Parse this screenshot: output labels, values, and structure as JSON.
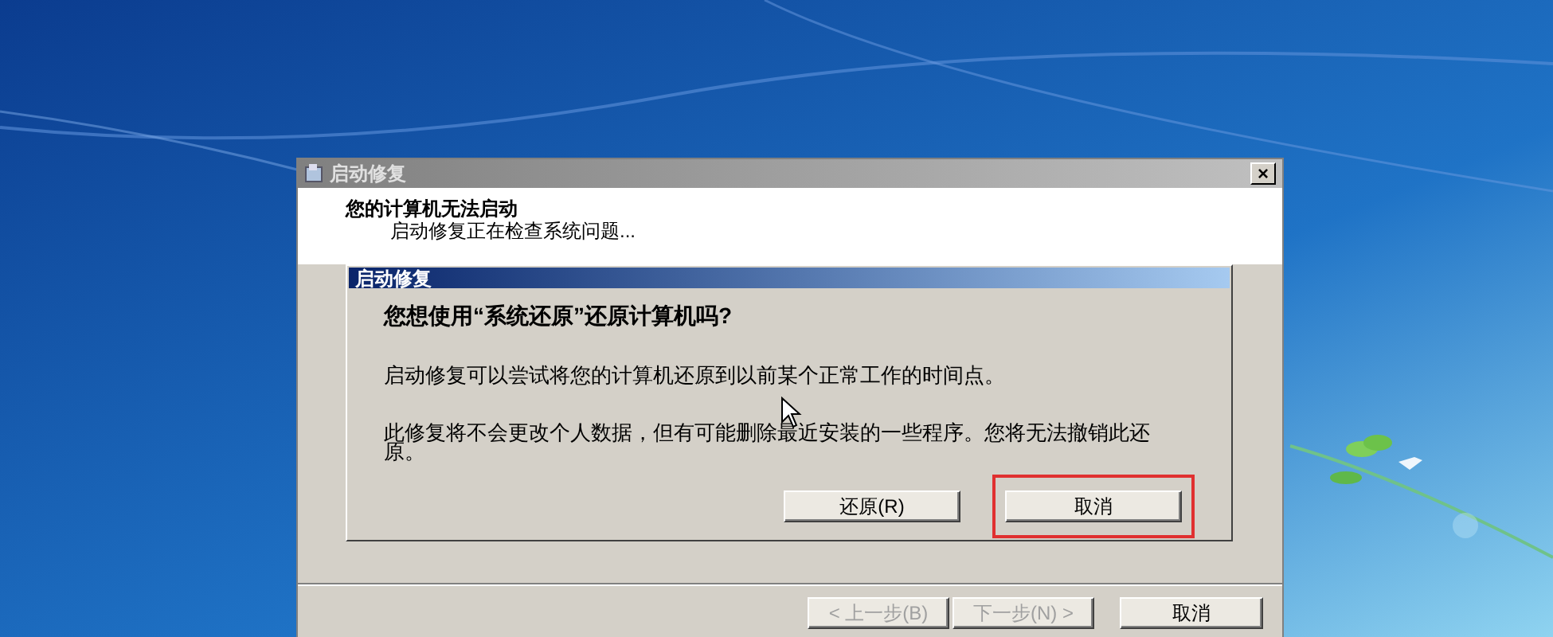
{
  "window": {
    "title": "启动修复",
    "close": "×"
  },
  "header": {
    "title": "您的计算机无法启动",
    "subtitle": "启动修复正在检查系统问题..."
  },
  "dialog": {
    "title": "启动修复",
    "question": "您想使用“系统还原”还原计算机吗?",
    "paragraphs": [
      "启动修复可以尝试将您的计算机还原到以前某个正常工作的时间点。",
      "此修复将不会更改个人数据，但有可能删除最近安装的一些程序。您将无法撤销此还原。"
    ],
    "buttons": [
      {
        "label": "还原(R)",
        "highlighted": false
      },
      {
        "label": "取消",
        "highlighted": true
      }
    ]
  },
  "footer_buttons": [
    {
      "label": "< 上一步(B)",
      "disabled": true
    },
    {
      "label": "下一步(N) >",
      "disabled": true
    },
    {
      "label": "取消",
      "disabled": false
    }
  ]
}
